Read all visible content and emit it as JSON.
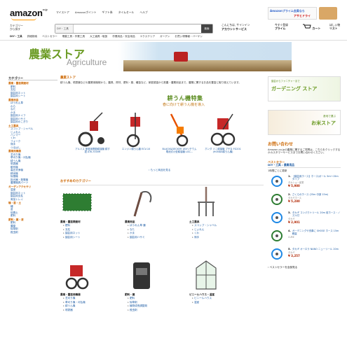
{
  "header": {
    "logo": "amazon",
    "logo_suffix": "co.jp",
    "top_links": [
      "マイストア",
      "Amazonポイント",
      "ギフト券",
      "タイムセール",
      "ヘルプ"
    ],
    "ad_line1": "Amazonプライム会員なら",
    "ad_line2": "アサヒドライ",
    "dept_label": "カテゴリー",
    "dept_sub": "から探す",
    "search_category": "DIY・工具",
    "search_button": "検索",
    "account_greet": "こんにちは, サインイン",
    "account_label": "アカウントサービス",
    "prime_line1": "今すぐ登録",
    "prime_label": "プライム",
    "cart_label": "カート",
    "wish_line1": "ほしい物",
    "wish_label": "リスト"
  },
  "nav": [
    "DIY・工具",
    "詳細検索",
    "ベストセラー",
    "電動工具・作業工具",
    "大工道具・取扱",
    "作業用品・安全用品",
    "エクステリア",
    "ガーデン",
    "お買い得情報・バーゲン"
  ],
  "banner": {
    "title": "農業ストア",
    "subtitle": "Agriculture"
  },
  "sidebar": {
    "heading": "カテゴリー",
    "items": [
      {
        "label": "農業・園芸関連材",
        "sec": true
      },
      {
        "label": "肥料",
        "sec": false
      },
      {
        "label": "支柱",
        "sec": false
      },
      {
        "label": "園芸用ネット",
        "sec": false
      },
      {
        "label": "園芸用シート",
        "sec": false
      },
      {
        "label": "農業用品",
        "sec": true
      },
      {
        "label": "ほうれん草",
        "sec": false
      },
      {
        "label": "わら",
        "sec": false
      },
      {
        "label": "なた",
        "sec": false
      },
      {
        "label": "かま",
        "sec": false
      },
      {
        "label": "園芸用ナイフ",
        "sec": false
      },
      {
        "label": "園芸用ハサミ",
        "sec": false
      },
      {
        "label": "園芸用のこぎり",
        "sec": false
      },
      {
        "label": "土工農具",
        "sec": true
      },
      {
        "label": "スコップ・シャベル",
        "sec": false
      },
      {
        "label": "じょれん",
        "sec": false
      },
      {
        "label": "ハンマー",
        "sec": false
      },
      {
        "label": "くわ",
        "sec": false
      },
      {
        "label": "フォーク",
        "sec": false
      },
      {
        "label": "熊手",
        "sec": false
      },
      {
        "label": "つるはし",
        "sec": false
      },
      {
        "label": "農業用機器",
        "sec": true
      },
      {
        "label": "芝刈り機",
        "sec": false
      },
      {
        "label": "草刈り機・刈払機",
        "sec": false
      },
      {
        "label": "耕うん機",
        "sec": false
      },
      {
        "label": "噴霧器",
        "sec": false
      },
      {
        "label": "散布機",
        "sec": false
      },
      {
        "label": "高圧洗浄機",
        "sec": false
      },
      {
        "label": "精米機",
        "sec": false
      },
      {
        "label": "除雪機",
        "sec": false
      },
      {
        "label": "投光器・発電機",
        "sec": false
      },
      {
        "label": "農業機具パーツ",
        "sec": false
      },
      {
        "label": "ガーデンアクセサリ",
        "sec": true
      },
      {
        "label": "温室",
        "sec": false
      },
      {
        "label": "園芸用ネット",
        "sec": false
      },
      {
        "label": "園芸用支柱",
        "sec": false
      },
      {
        "label": "育苗トレイ",
        "sec": false
      },
      {
        "label": "種・苗・土",
        "sec": true
      },
      {
        "label": "種",
        "sec": false
      },
      {
        "label": "苗",
        "sec": false
      },
      {
        "label": "培養土",
        "sec": false
      },
      {
        "label": "肥料",
        "sec": false
      },
      {
        "label": "肥料・薬・液",
        "sec": true
      },
      {
        "label": "肥料",
        "sec": false
      },
      {
        "label": "農薬",
        "sec": false
      },
      {
        "label": "除草剤",
        "sec": false
      },
      {
        "label": "殺虫剤",
        "sec": false
      }
    ]
  },
  "main": {
    "title": "農業ストア",
    "intro": "耕うん機、噴霧器などの農業用機械から、農具、資材、肥料・薬、種苗など、家庭菜園から営農・農業用品まで、農業に関するお品を豊富に取り揃えています。",
    "feature_title": "耕うん機特集",
    "feature_sub": "春に向けて耕うん機を導入",
    "tillers": [
      {
        "name": "アルミス 家庭用電動耕運機 耕す君 ATK-700VR"
      },
      {
        "name": "エンジン耕うん機 ECV-10"
      },
      {
        "name": "BLACK&DECKER 18Vリチウム 電池式小型耕運機 LGC…"
      },
      {
        "name": "ホンダ ミニ耕運機 プチな FG201 (HONDA耕うん機)"
      }
    ],
    "more_link": "› もっと商品を見る",
    "rec_title": "おすすめのカテゴリー",
    "categories": [
      {
        "title": "農業・園芸関連材",
        "items": [
          "肥料",
          "支柱",
          "園芸用ネット",
          "園芸用シート"
        ]
      },
      {
        "title": "農業用品",
        "items": [
          "ほうれん草 鎌",
          "なた",
          "かま",
          "園芸用ハサミ"
        ]
      },
      {
        "title": "土工農具",
        "items": [
          "スコップ・シャベル",
          "じょれん",
          "くわ",
          "熊手"
        ]
      },
      {
        "title": "農業・園芸用機器",
        "items": [
          "芝刈り機",
          "草刈り機・刈払機",
          "耕うん機",
          "噴霧器"
        ]
      },
      {
        "title": "肥料・薬",
        "items": [
          "肥料",
          "除草剤",
          "植物成長調整剤",
          "殺虫剤"
        ]
      },
      {
        "title": "ビニールハウス・温室",
        "items": [
          "ビニールハウス",
          "温室"
        ]
      }
    ]
  },
  "right": {
    "garden_line1": "園芸からファニチャーまで",
    "garden_title": "ガーデニング ストア",
    "rice_line1": "産地で選ぶ",
    "rice_title": "お米ストア",
    "inquiry_title": "お問い合わせ",
    "inquiry_text": "Amazon.co.jpの農業に関するご質問は、こちらをクリックするかカスタマーサービスまでお問い合わせください。",
    "best_title": "ベストセラー",
    "best_sub": "DIY・工具 : 農業用品",
    "best_updated": "1時間ごとに更新",
    "bestsellers": [
      {
        "rank": "1.",
        "name": "【農芸用ホース】ホース/ボール 5m～15mタイプ",
        "seller": "タカショー産業",
        "price": "¥ 5,980"
      },
      {
        "rank": "2.",
        "name": "さくらのホース (25m 中部 15m)",
        "seller": "タカギホース",
        "price": "¥ 5,280"
      },
      {
        "rank": "3.",
        "name": "タカギ コンパクトリール 20m 前ホース・ノズル付",
        "seller": "タカギ",
        "price": "¥ 2,901"
      },
      {
        "rank": "4.",
        "name": "ガーデニングや洗車に SHOSE ホース 15m 軽量",
        "seller": "CURE",
        "price": ""
      },
      {
        "rank": "5.",
        "name": "タカギ オーロラ NANO ニューリール 20m",
        "seller": "タカギ",
        "price": "¥ 3,257"
      }
    ],
    "best_more": "› ベストセラーを全部見る"
  }
}
